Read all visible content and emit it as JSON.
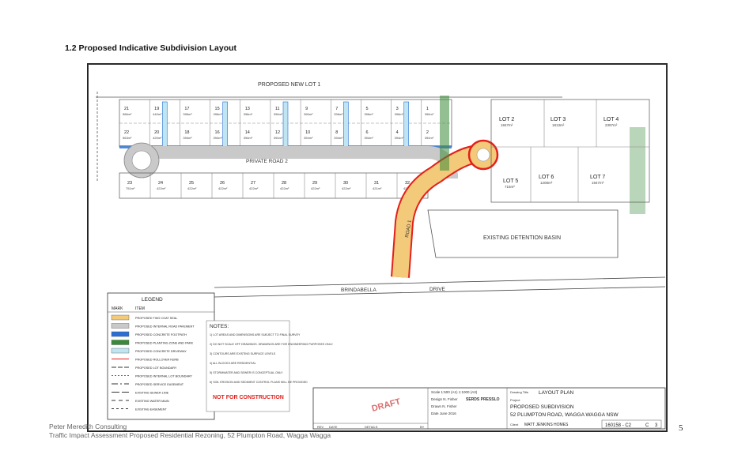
{
  "heading": "1.2 Proposed Indicative Subdivision Layout",
  "plan": {
    "new_lot_label": "PROPOSED NEW LOT 1",
    "private_road": "PRIVATE ROAD 2",
    "road_1": "ROAD 1",
    "street": [
      "BRINDABELLA",
      "DRIVE"
    ],
    "detention_basin": "EXISTING DETENTION BASIN",
    "lots_top_row": [
      {
        "no": "21",
        "area": "586m²"
      },
      {
        "no": "19",
        "area": "440m²"
      },
      {
        "no": "17",
        "area": "396m²"
      },
      {
        "no": "15",
        "area": "396m²"
      },
      {
        "no": "13",
        "area": "396m²"
      },
      {
        "no": "11",
        "area": "396m²"
      },
      {
        "no": "9",
        "area": "396m²"
      },
      {
        "no": "7",
        "area": "396m²"
      },
      {
        "no": "5",
        "area": "396m²"
      },
      {
        "no": "3",
        "area": "396m²"
      },
      {
        "no": "1",
        "area": "396m²"
      }
    ],
    "lots_second_row": [
      {
        "no": "22",
        "area": "563m²"
      },
      {
        "no": "20",
        "area": "420m²"
      },
      {
        "no": "18",
        "area": "394m²"
      },
      {
        "no": "16",
        "area": "394m²"
      },
      {
        "no": "14",
        "area": "394m²"
      },
      {
        "no": "12",
        "area": "394m²"
      },
      {
        "no": "10",
        "area": "394m²"
      },
      {
        "no": "8",
        "area": "394m²"
      },
      {
        "no": "6",
        "area": "394m²"
      },
      {
        "no": "4",
        "area": "394m²"
      },
      {
        "no": "2",
        "area": "394m²"
      }
    ],
    "lots_south_row": [
      {
        "no": "23",
        "area": "751m²"
      },
      {
        "no": "24",
        "area": "422m²"
      },
      {
        "no": "25",
        "area": "422m²"
      },
      {
        "no": "26",
        "area": "422m²"
      },
      {
        "no": "27",
        "area": "422m²"
      },
      {
        "no": "28",
        "area": "422m²"
      },
      {
        "no": "29",
        "area": "422m²"
      },
      {
        "no": "30",
        "area": "422m²"
      },
      {
        "no": "31",
        "area": "421m²"
      },
      {
        "no": "32",
        "area": "422m²"
      }
    ],
    "east_lots": [
      {
        "no": "LOT 2",
        "area": "1847m²"
      },
      {
        "no": "LOT 3",
        "area": "1813m²"
      },
      {
        "no": "LOT 4",
        "area": "2397m²"
      },
      {
        "no": "LOT 5",
        "area": "715m²"
      },
      {
        "no": "LOT 6",
        "area": "1208m²"
      },
      {
        "no": "LOT 7",
        "area": "1947m²"
      }
    ]
  },
  "legend": {
    "title": "LEGEND",
    "col_mark": "MARK",
    "col_item": "ITEM",
    "items": [
      "PROPOSED TWO COAT SEAL",
      "PROPOSED INTERNAL ROAD PAVEMENT",
      "PROPOSED CONCRETE FOOTPATH",
      "PROPOSED PLANTING ZONE AND PARK",
      "PROPOSED CONCRETE DRIVEWAY",
      "PROPOSED ROLLOVER KERB",
      "PROPOSED LOT BOUNDARY",
      "PROPOSED INTERNAL LOT BOUNDARY",
      "PROPOSED SERVICE EASEMENT",
      "EXISTING SEWER LINE",
      "EXISTING WATER MAIN",
      "EXISTING EASEMENT"
    ]
  },
  "notes": {
    "title": "NOTES:",
    "items": [
      "1) LOT AREAS AND DIMENSIONS ARE SUBJECT TO FINAL SURVEY",
      "2) DO NOT SCALE OFF DRAWINGS. DRAWINGS ARE FOR ENGINEERING PURPOSES ONLY.",
      "3) CONTOURS ARE EXISTING SURFACE LEVELS",
      "4) ALL BLOCKS ARE RESIDENTIAL",
      "5) STORMWATER AND SEWER IS CONCEPTUAL ONLY",
      "6) SOIL EROSION AND SEDIMENT CONTROL PLANS WILL BE PROVIDED"
    ],
    "stamp": "NOT FOR CONSTRUCTION"
  },
  "title_block": {
    "scale": "Scale 1:500 (A1)  1:1000 (A3)",
    "design": "Design  N. Fisher",
    "drawn": "Drawn  N. Fisher",
    "date": "Date  June 2016",
    "draft": "DRAFT",
    "consultant": "SERDS PRESSLO",
    "drawing_title_label": "Drawing Title",
    "drawing_title": "LAYOUT PLAN",
    "project_label": "Project",
    "project": "PROPOSED SUBDIVISION",
    "address": "52 PLUMPTON ROAD, WAGGA WAGGA NSW",
    "client_label": "Client",
    "client": "MATT JENKINS HOMES",
    "drawing_no": "160158 - C2",
    "rev": "C",
    "sheet": "3",
    "revisions_header": [
      "REV",
      "DATE",
      "DETAILS",
      "BY"
    ]
  },
  "footer": {
    "company": "Peter Meredith Consulting",
    "document": "Traffic Impact Assessment Proposed Residential Rezoning, 52 Plumpton Road, Wagga Wagga",
    "page": "5"
  },
  "colors": {
    "road_seal": "#f3c97a",
    "pavement": "#c9c9c9",
    "footpath": "#2a6fd6",
    "planting": "#3a8a3a",
    "driveway": "#bfe4f2",
    "rollover_kerb": "#e3201b",
    "draft_stamp": "#c62020"
  }
}
